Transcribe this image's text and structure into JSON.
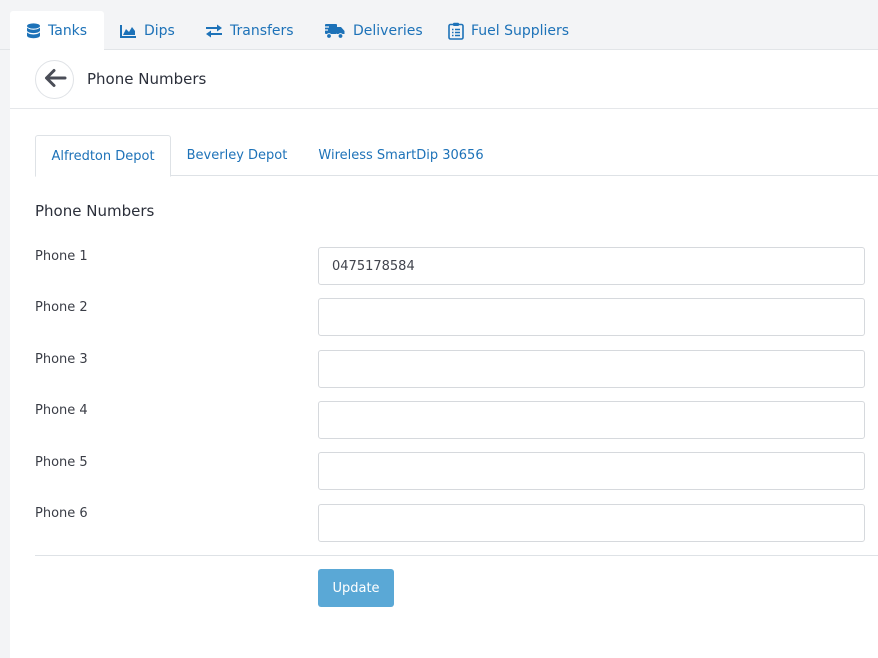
{
  "nav": {
    "items": [
      {
        "label": "Tanks",
        "icon": "database-icon",
        "active": true
      },
      {
        "label": "Dips",
        "icon": "area-chart-icon",
        "active": false
      },
      {
        "label": "Transfers",
        "icon": "exchange-arrows-icon",
        "active": false
      },
      {
        "label": "Deliveries",
        "icon": "truck-icon",
        "active": false
      },
      {
        "label": "Fuel Suppliers",
        "icon": "clipboard-list-icon",
        "active": false
      }
    ]
  },
  "header": {
    "back_icon": "arrow-left-icon",
    "title": "Phone Numbers"
  },
  "tabs": [
    {
      "label": "Alfredton Depot",
      "active": true
    },
    {
      "label": "Beverley Depot",
      "active": false
    },
    {
      "label": "Wireless SmartDip 30656",
      "active": false
    }
  ],
  "form": {
    "section_title": "Phone Numbers",
    "fields": [
      {
        "label": "Phone 1",
        "value": "0475178584"
      },
      {
        "label": "Phone 2",
        "value": ""
      },
      {
        "label": "Phone 3",
        "value": ""
      },
      {
        "label": "Phone 4",
        "value": ""
      },
      {
        "label": "Phone 5",
        "value": ""
      },
      {
        "label": "Phone 6",
        "value": ""
      }
    ],
    "update_label": "Update"
  },
  "colors": {
    "accent": "#1d72b8",
    "button": "#5aa8d6",
    "background": "#f3f4f6"
  }
}
